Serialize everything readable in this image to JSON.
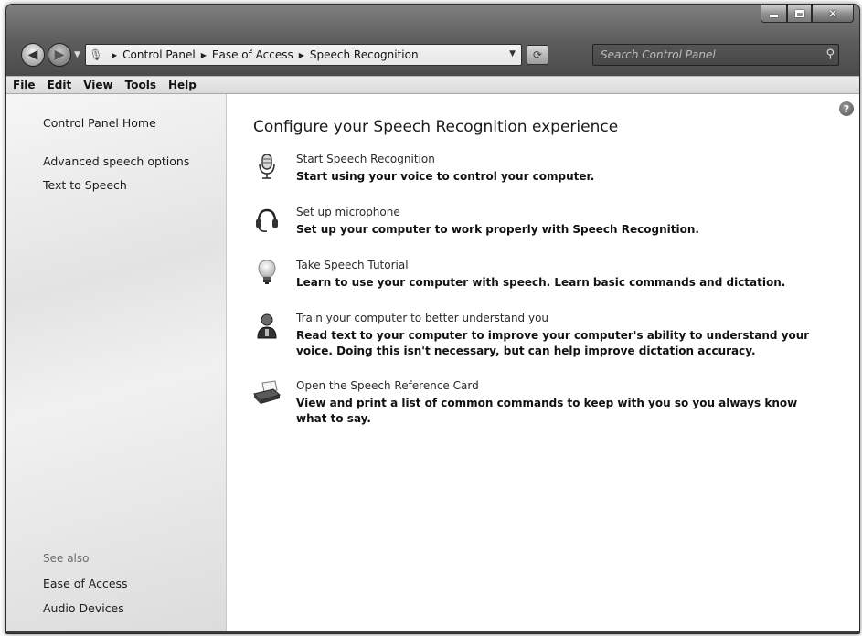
{
  "window": {
    "caption": {
      "minimize": "minimize",
      "maximize": "maximize",
      "close": "close"
    }
  },
  "nav": {
    "address": [
      "Control Panel",
      "Ease of Access",
      "Speech Recognition"
    ],
    "search_placeholder": "Search Control Panel"
  },
  "menubar": [
    "File",
    "Edit",
    "View",
    "Tools",
    "Help"
  ],
  "sidebar": {
    "home": "Control Panel Home",
    "links": [
      "Advanced speech options",
      "Text to Speech"
    ],
    "see_also_title": "See also",
    "see_also": [
      "Ease of Access",
      "Audio Devices"
    ]
  },
  "main": {
    "title": "Configure your Speech Recognition experience",
    "tasks": [
      {
        "link": "Start Speech Recognition",
        "desc": "Start using your voice to control your computer.",
        "icon": "microphone-icon"
      },
      {
        "link": "Set up microphone",
        "desc": "Set up your computer to work properly with Speech Recognition.",
        "icon": "headset-icon"
      },
      {
        "link": "Take Speech Tutorial",
        "desc": "Learn to use your computer with speech.  Learn basic commands and dictation.",
        "icon": "lightbulb-icon"
      },
      {
        "link": "Train your computer to better understand you",
        "desc": "Read text to your computer to improve your computer's ability to understand your voice. Doing this isn't necessary, but can help improve dictation accuracy.",
        "icon": "person-icon"
      },
      {
        "link": "Open the Speech Reference Card",
        "desc": "View and print a list of common commands to keep with you so you always know what to say.",
        "icon": "printer-icon"
      }
    ]
  },
  "colors": {
    "accent_link": "#2a2a2a",
    "frame": "#4a4a4a"
  }
}
